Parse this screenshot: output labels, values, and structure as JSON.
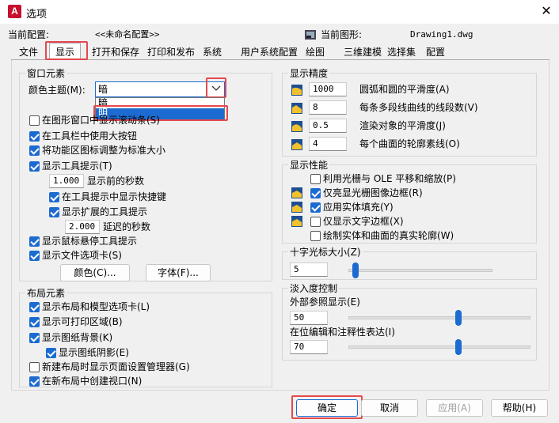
{
  "window": {
    "title": "选项"
  },
  "header": {
    "current_profile_label": "当前配置:",
    "current_profile_value": "<<未命名配置>>",
    "current_drawing_label": "当前图形:",
    "current_drawing_value": "Drawing1.dwg"
  },
  "tabs": [
    "文件",
    "显示",
    "打开和保存",
    "打印和发布",
    "系统",
    "用户系统配置",
    "绘图",
    "三维建模",
    "选择集",
    "配置"
  ],
  "window_elements": {
    "title": "窗口元素",
    "color_theme_label": "颜色主题(M):",
    "color_theme_value": "暗",
    "dropdown_options": [
      "暗",
      "明"
    ],
    "scrollbars_label": "在图形窗口中显示滚动条(S)",
    "large_buttons_label": "在工具栏中使用大按钮",
    "resize_ribbon_label": "将功能区图标调整为标准大小",
    "tooltips_label": "显示工具提示(T)",
    "delay_value": "1.000",
    "delay_label": "显示前的秒数",
    "shortcut_keys_label": "在工具提示中显示快捷键",
    "extended_tooltips_label": "显示扩展的工具提示",
    "extended_delay_value": "2.000",
    "extended_delay_label": "延迟的秒数",
    "rollover_label": "显示鼠标悬停工具提示",
    "file_tabs_label": "显示文件选项卡(S)",
    "colors_button": "颜色(C)...",
    "fonts_button": "字体(F)..."
  },
  "layout_elements": {
    "title": "布局元素",
    "layout_tabs_label": "显示布局和模型选项卡(L)",
    "printable_area_label": "显示可打印区域(B)",
    "paper_background_label": "显示图纸背景(K)",
    "paper_shadow_label": "显示图纸阴影(E)",
    "page_setup_label": "新建布局时显示页面设置管理器(G)",
    "create_viewport_label": "在新布局中创建视口(N)"
  },
  "display_resolution": {
    "title": "显示精度",
    "arc_smoothness_value": "1000",
    "arc_smoothness_label": "圆弧和圆的平滑度(A)",
    "polyline_segments_value": "8",
    "polyline_segments_label": "每条多段线曲线的线段数(V)",
    "render_smoothness_value": "0.5",
    "render_smoothness_label": "渲染对象的平滑度(J)",
    "contour_lines_value": "4",
    "contour_lines_label": "每个曲面的轮廓素线(O)"
  },
  "display_performance": {
    "title": "显示性能",
    "raster_pan_label": "利用光栅与 OLE 平移和缩放(P)",
    "highlight_raster_label": "仅亮显光栅图像边框(R)",
    "solid_fill_label": "应用实体填充(Y)",
    "text_frame_label": "仅显示文字边框(X)",
    "true_silhouettes_label": "绘制实体和曲面的真实轮廓(W)"
  },
  "crosshair": {
    "title": "十字光标大小(Z)",
    "value": "5",
    "level": 0.05
  },
  "fade_control": {
    "title": "淡入度控制",
    "xref_label": "外部参照显示(E)",
    "xref_value": "50",
    "xref_level": 0.5,
    "inplace_label": "在位编辑和注释性表达(I)",
    "inplace_value": "70",
    "inplace_level": 0.5
  },
  "buttons": {
    "ok": "确定",
    "cancel": "取消",
    "apply": "应用(A)",
    "help": "帮助(H)"
  },
  "colors": {
    "accent": "#1c6bd1",
    "highlight_box": "#e5484d"
  }
}
